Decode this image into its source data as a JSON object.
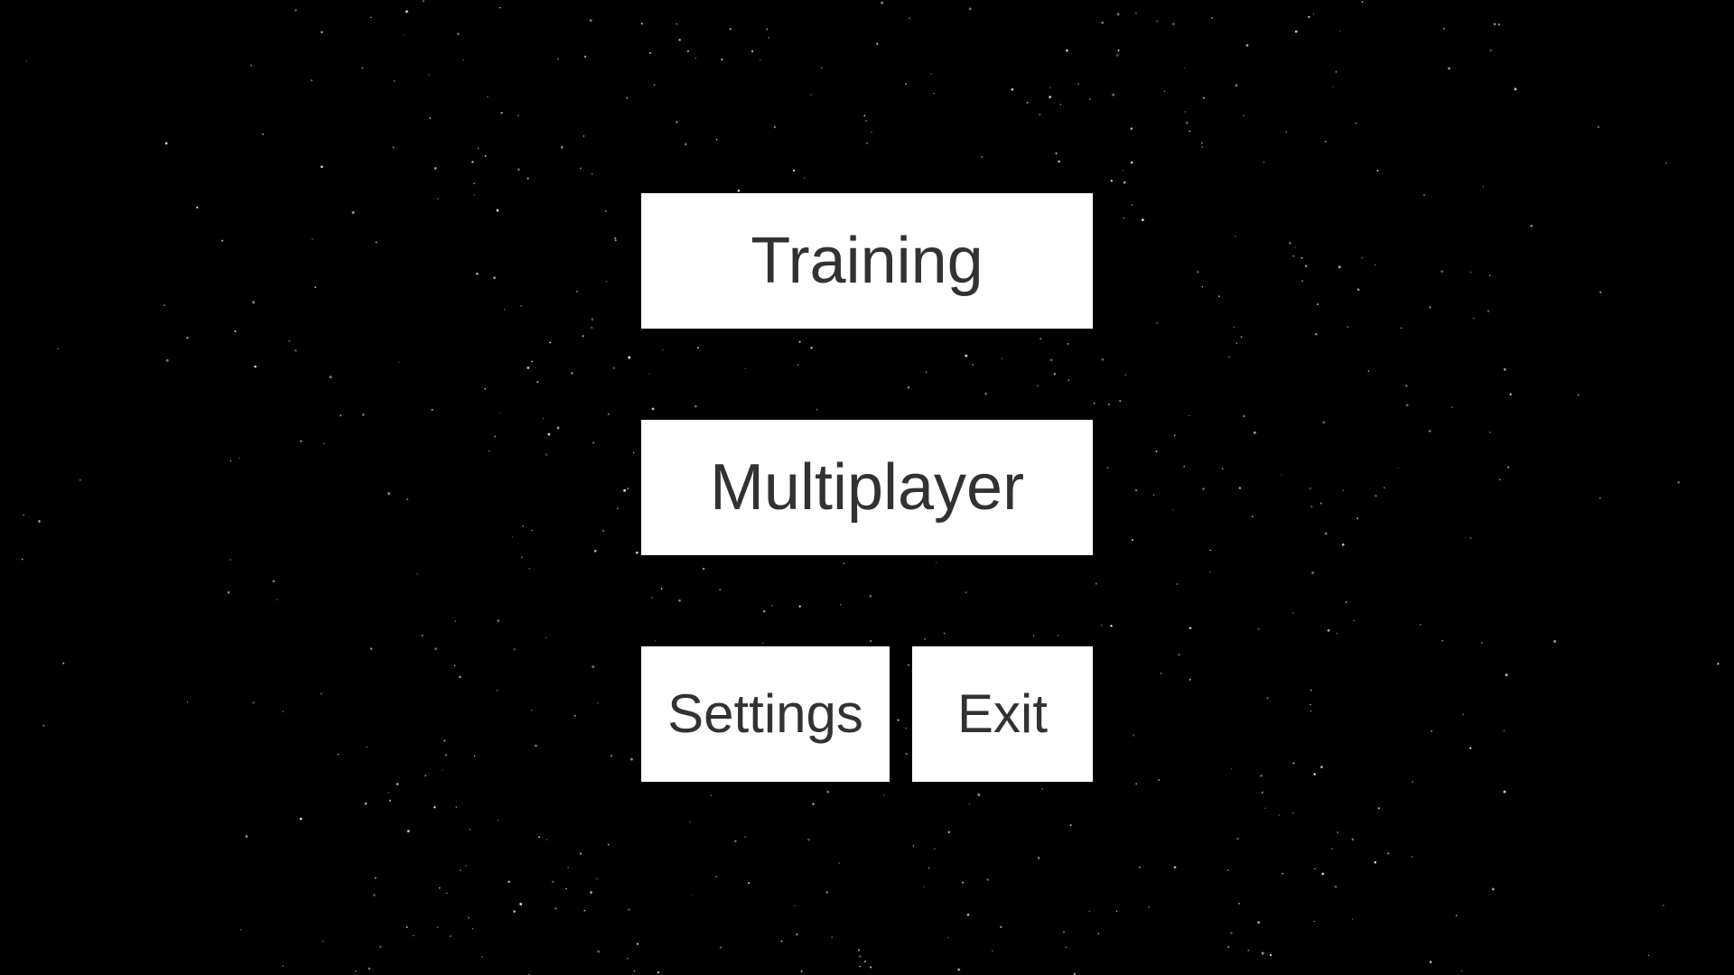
{
  "background": {
    "color": "#000000",
    "style": "starfield"
  },
  "menu": {
    "training_label": "Training",
    "multiplayer_label": "Multiplayer",
    "settings_label": "Settings",
    "exit_label": "Exit"
  },
  "colors": {
    "button_background": "#ffffff",
    "button_text": "#323232",
    "star": "#ffffff"
  }
}
